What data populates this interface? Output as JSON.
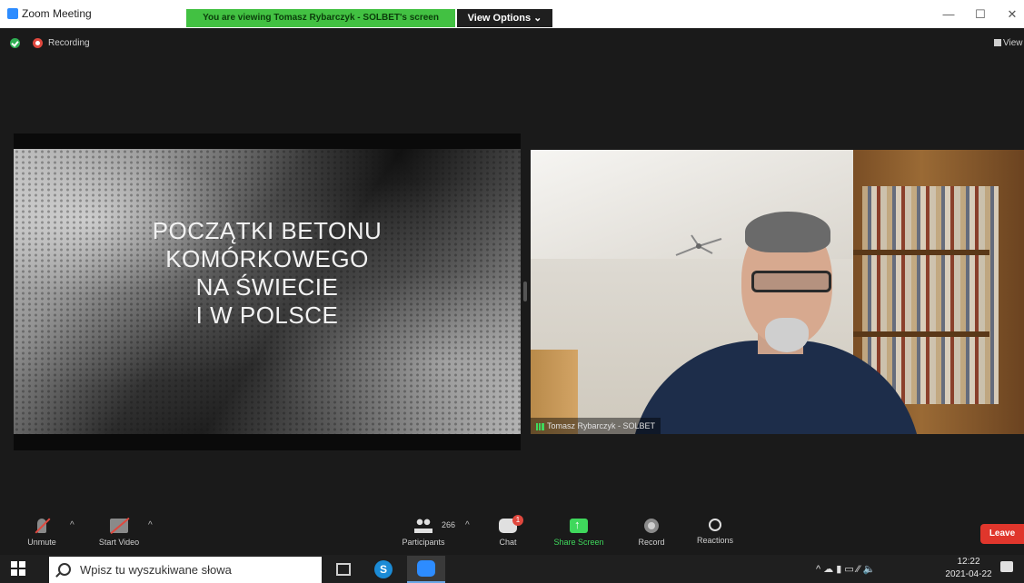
{
  "window": {
    "title": "Zoom Meeting",
    "share_banner": "You are viewing Tomasz Rybarczyk - SOLBET's screen",
    "view_options": "View Options ⌄",
    "controls": {
      "minimize": "—",
      "maximize": "☐",
      "close": "✕"
    }
  },
  "meeting": {
    "recording_label": "Recording",
    "view_label": "View"
  },
  "slide": {
    "title_lines": [
      "POCZĄTKI BETONU",
      "KOMÓRKOWEGO",
      "NA ŚWIECIE",
      "I W POLSCE"
    ]
  },
  "speaker": {
    "name_tag": "Tomasz Rybarczyk - SOLBET"
  },
  "toolbar": {
    "unmute": "Unmute",
    "start_video": "Start Video",
    "participants": "Participants",
    "participant_count": "266",
    "chat": "Chat",
    "chat_badge": "1",
    "share_screen": "Share Screen",
    "record": "Record",
    "reactions": "Reactions",
    "leave": "Leave",
    "caret": "^"
  },
  "taskbar": {
    "search_placeholder": "Wpisz tu wyszukiwane słowa",
    "skype_letter": "S",
    "tray_text": "^ ☁ ▮ ▭ ⁄⁄ 🔈",
    "time": "12:22",
    "date": "2021-04-22"
  },
  "colors": {
    "share_green": "#42c142",
    "leave_red": "#e0362c",
    "zoom_blue": "#2d8cff",
    "recording_red": "#e0483e"
  }
}
